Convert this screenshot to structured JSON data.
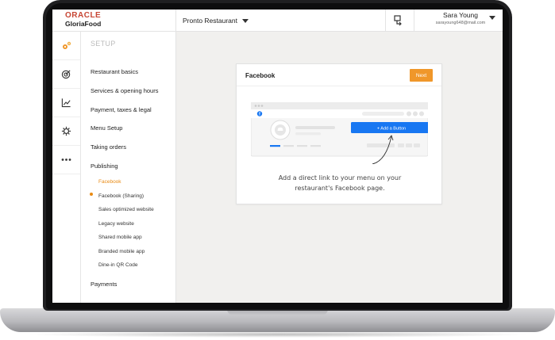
{
  "brand": {
    "oracle": "ORACLE",
    "product": "GloriaFood",
    "accent": "#e88a14",
    "oracle_red": "#c74634"
  },
  "topbar": {
    "restaurant": "Pronto Restaurant",
    "restaurant_icon": "chevron-down-icon",
    "switch_icon": "switch-icon",
    "user_name": "Sara Young",
    "user_email": "sarayoung648@mail.com"
  },
  "rail": {
    "items": [
      {
        "icon": "gears-icon",
        "active": true
      },
      {
        "icon": "target-icon"
      },
      {
        "icon": "chart-icon"
      },
      {
        "icon": "settings-icon"
      },
      {
        "icon": "more-icon"
      }
    ]
  },
  "sidebar": {
    "heading": "SETUP",
    "items": [
      "Restaurant basics",
      "Services & opening hours",
      "Payment, taxes & legal",
      "Menu Setup",
      "Taking orders",
      "Publishing"
    ],
    "publishing_sub": [
      "Facebook",
      "Facebook (Sharing)",
      "Sales optimized website",
      "Legacy website",
      "Shared mobile app",
      "Branded mobile app",
      "Dine-in QR Code"
    ],
    "active_sub": "Facebook",
    "payments": "Payments"
  },
  "card": {
    "title": "Facebook",
    "next_label": "Next",
    "button_preview": "+ Add a Button",
    "caption_line1": "Add a direct link to your menu on your",
    "caption_line2": "restaurant's Facebook page."
  }
}
